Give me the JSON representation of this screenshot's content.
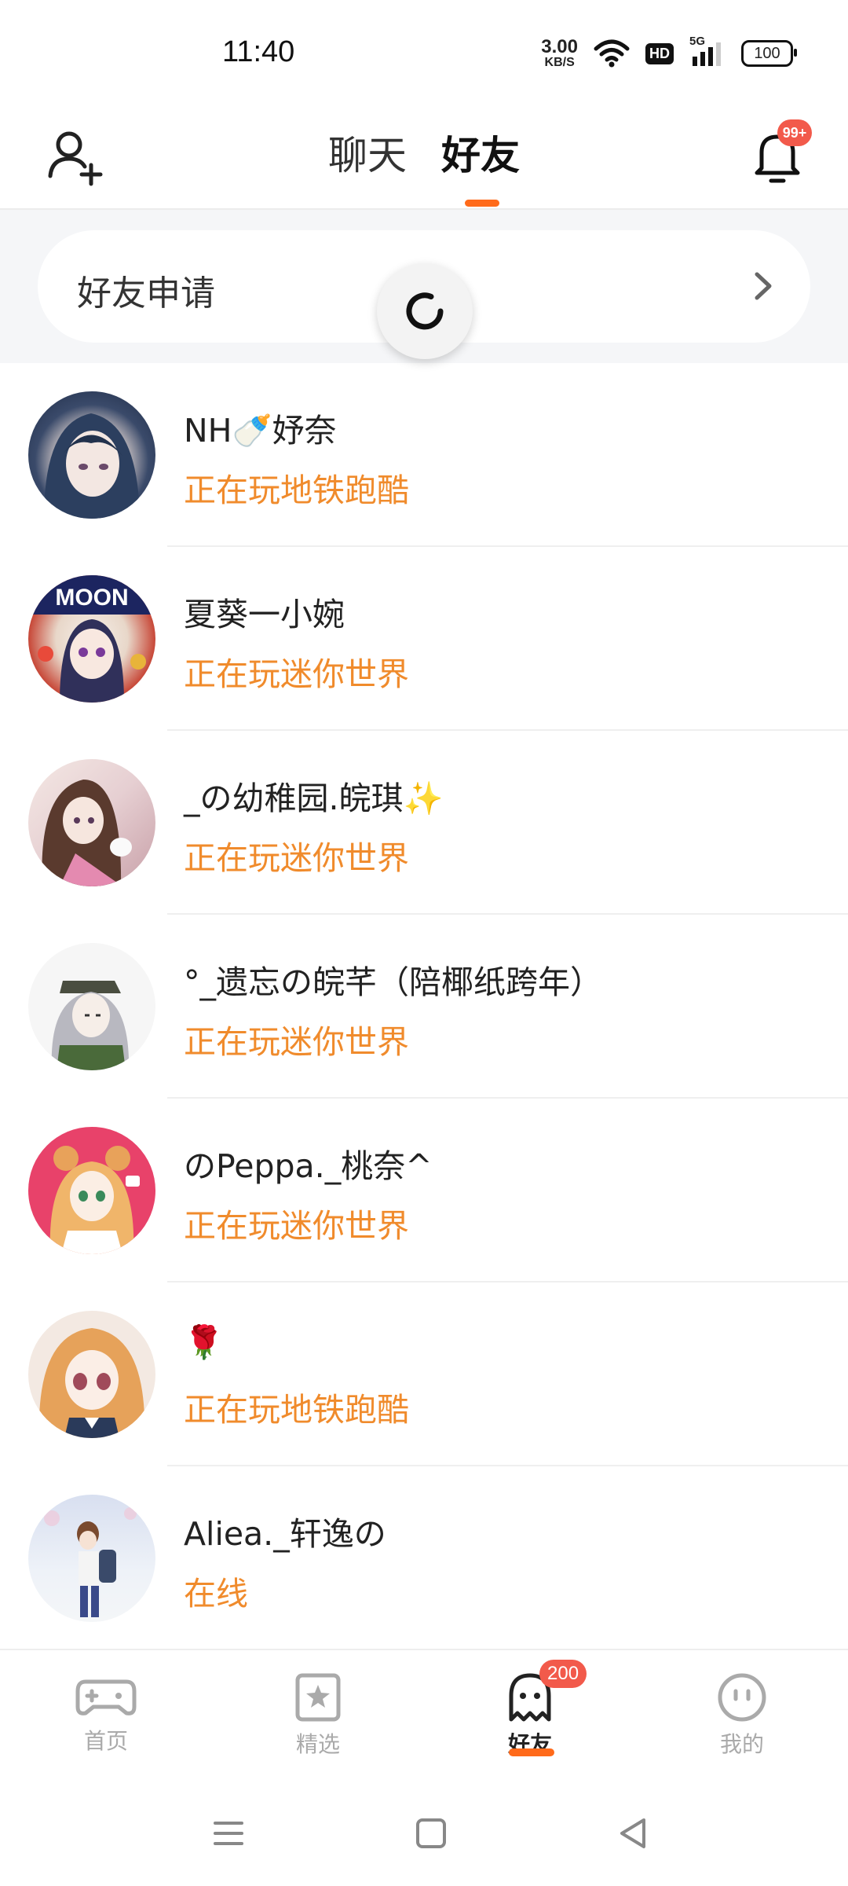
{
  "status_bar": {
    "time": "11:40",
    "net_speed_value": "3.00",
    "net_speed_unit": "KB/S",
    "hd_label": "HD",
    "network_label": "5G",
    "battery": "100"
  },
  "header": {
    "tabs": [
      {
        "label": "聊天",
        "active": false
      },
      {
        "label": "好友",
        "active": true
      }
    ],
    "notification_badge": "99+",
    "accent_color": "#ff6a1a"
  },
  "friend_request": {
    "label": "好友申请"
  },
  "friends": [
    {
      "name": "NH🍼妤奈",
      "status": "正在玩地铁跑酷"
    },
    {
      "name": "夏葵一小婉",
      "status": "正在玩迷你世界"
    },
    {
      "name": "_の幼稚园.皖琪✨",
      "status": "正在玩迷你世界"
    },
    {
      "name": "°_遗忘の皖芊（陪椰纸跨年）",
      "status": "正在玩迷你世界"
    },
    {
      "name": "のPeppa._桃奈^",
      "status": "正在玩迷你世界"
    },
    {
      "name": "🌹",
      "status": "正在玩地铁跑酷"
    },
    {
      "name": "Aliea._轩逸の",
      "status": "在线"
    }
  ],
  "bottom_nav": {
    "items": [
      {
        "label": "首页",
        "icon": "gamepad-icon"
      },
      {
        "label": "精选",
        "icon": "star-bookmark-icon"
      },
      {
        "label": "好友",
        "icon": "ghost-icon"
      },
      {
        "label": "我的",
        "icon": "face-icon"
      }
    ],
    "friends_badge": "200"
  }
}
